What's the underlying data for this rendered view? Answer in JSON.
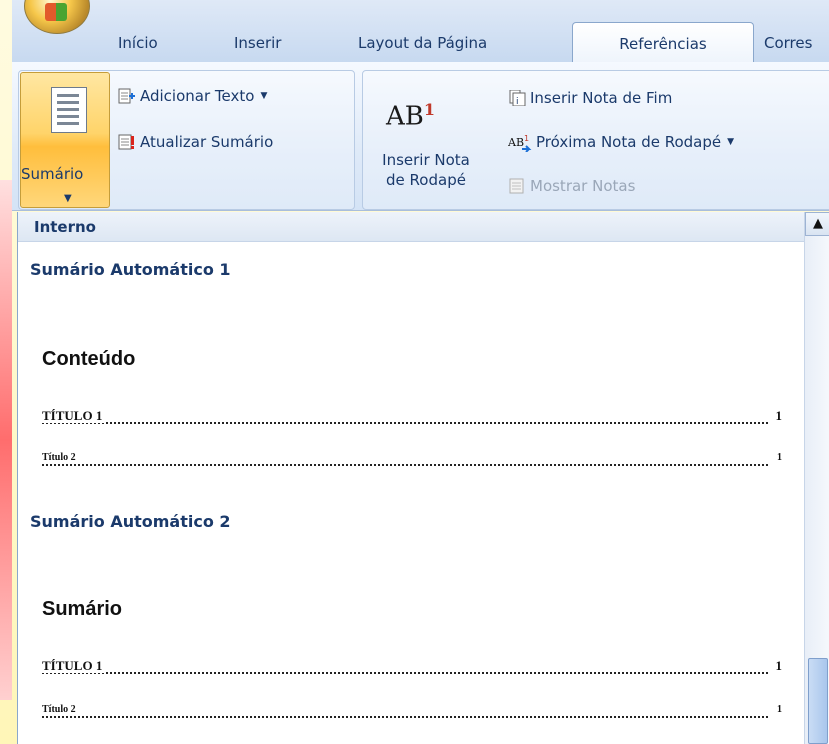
{
  "tabs": [
    {
      "label": "Início"
    },
    {
      "label": "Inserir"
    },
    {
      "label": "Layout da Página"
    },
    {
      "label": "Referências"
    },
    {
      "label": "Corres"
    }
  ],
  "ribbon": {
    "sumario_label": "Sumário",
    "adicionar_texto": "Adicionar Texto",
    "atualizar_sumario": "Atualizar Sumário",
    "inserir_nota_icon": "AB",
    "inserir_nota_sup": "1",
    "inserir_nota_line1": "Inserir Nota",
    "inserir_nota_line2": "de Rodapé",
    "inserir_nota_fim": "Inserir Nota de Fim",
    "proxima_nota": "Próxima Nota de Rodapé",
    "mostrar_notas": "Mostrar Notas"
  },
  "gallery": {
    "header": "Interno",
    "items": [
      {
        "name": "Sumário Automático 1",
        "preview_title": "Conteúdo",
        "lines": [
          {
            "text": "TÍTULO 1",
            "page": "1"
          },
          {
            "text": "Título 2",
            "page": "1"
          }
        ]
      },
      {
        "name": "Sumário Automático 2",
        "preview_title": "Sumário",
        "lines": [
          {
            "text": "TÍTULO 1",
            "page": "1"
          },
          {
            "text": "Título 2",
            "page": "1"
          }
        ]
      }
    ]
  },
  "icons": {
    "office": "office-button-icon",
    "sumario": "table-of-contents-icon",
    "adicionar": "add-text-icon",
    "atualizar": "update-table-icon",
    "nota_fim": "insert-endnote-icon",
    "proxima": "next-footnote-icon",
    "mostrar": "show-notes-icon"
  }
}
